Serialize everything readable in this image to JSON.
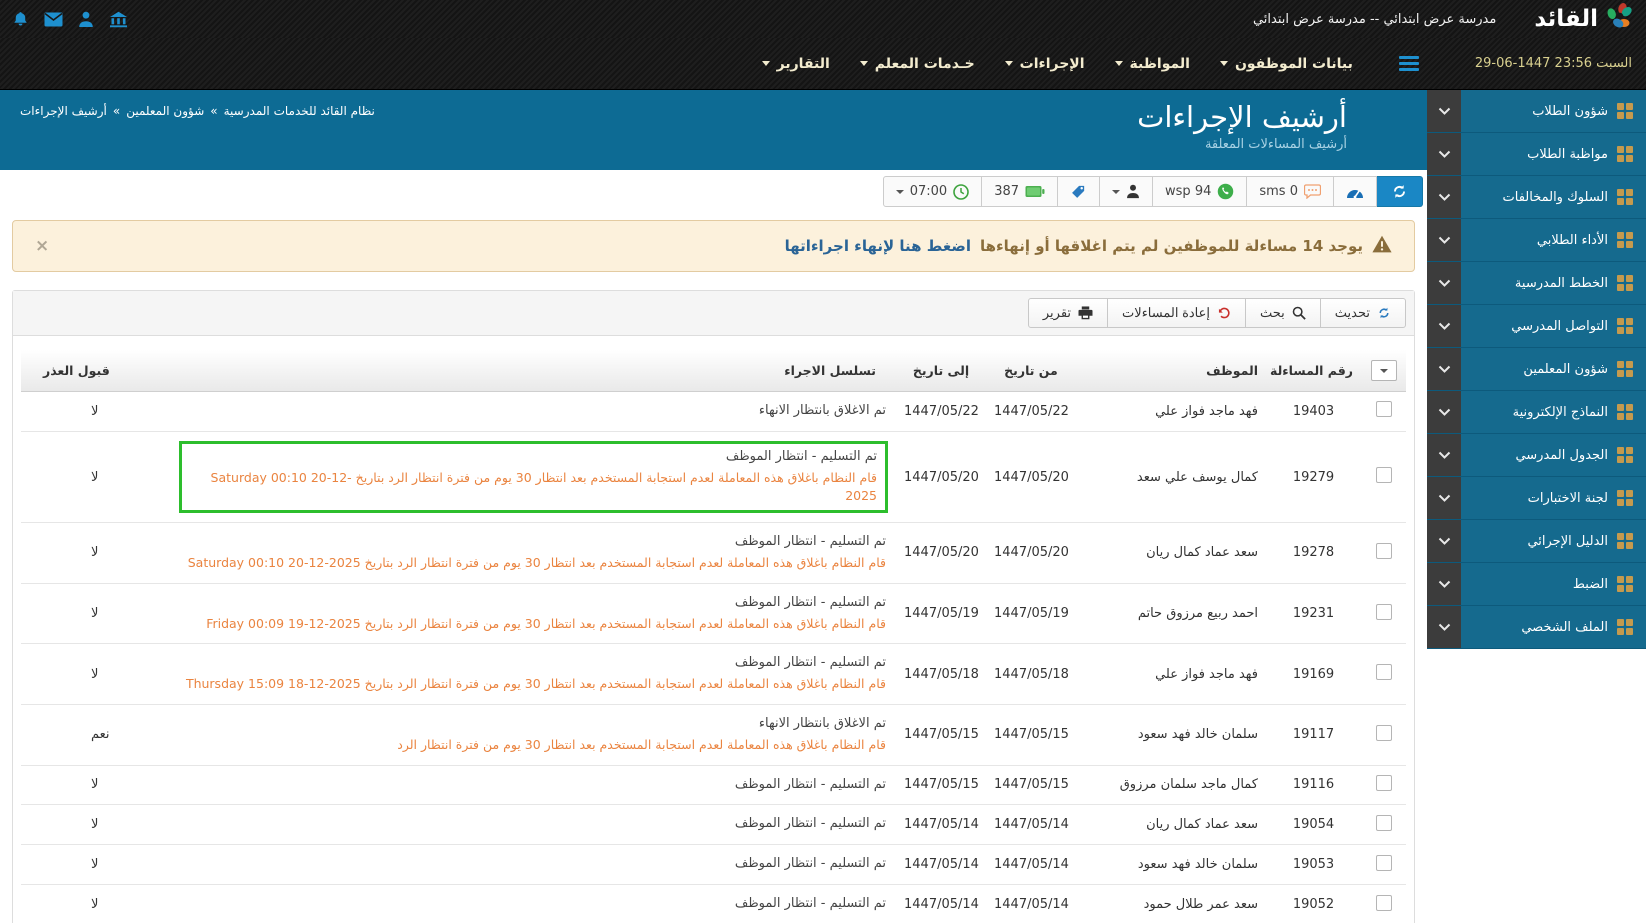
{
  "topbar": {
    "brand": "القائد",
    "school": "مدرسة عرض ابتدائي -- مدرسة عرض ابتدائي",
    "icons": [
      "bell-icon",
      "mail-icon",
      "user-icon",
      "bank-icon"
    ]
  },
  "navbar": {
    "datetime": "29-06-1447 23:56 السبت",
    "menu_icon": "hamburger-icon",
    "items": [
      {
        "label": "بيانات الموظفون"
      },
      {
        "label": "المواظبة"
      },
      {
        "label": "الإجراءات"
      },
      {
        "label": "خـدمات المعلم"
      },
      {
        "label": "التقارير"
      }
    ]
  },
  "sidebar": {
    "items": [
      {
        "label": "شؤون الطلاب"
      },
      {
        "label": "مواظبة الطلاب"
      },
      {
        "label": "السلوك والمخالفات"
      },
      {
        "label": "الأداء الطلابي"
      },
      {
        "label": "الخطط المدرسية"
      },
      {
        "label": "التواصل المدرسي"
      },
      {
        "label": "شؤون المعلمين"
      },
      {
        "label": "النماذج الإلكترونية"
      },
      {
        "label": "الجدول المدرسي"
      },
      {
        "label": "لجنة الاختبارات"
      },
      {
        "label": "الدليل الإجرائي"
      },
      {
        "label": "الضبط"
      },
      {
        "label": "الملف الشخصي"
      }
    ]
  },
  "page_header": {
    "title": "أرشيف الإجراءات",
    "subtitle": "أرشيف المساءلات المعلقة",
    "breadcrumb": {
      "part1": "نظام القائد للخدمات المدرسية",
      "part2": "شؤون المعلمين",
      "part3": "أرشيف الإجراءات",
      "sep": "»"
    }
  },
  "toolbar": {
    "time": "07:00",
    "battery_count": "387",
    "wsp_label": "wsp 94",
    "sms_label": "sms 0",
    "icons": [
      "refresh-icon",
      "speedometer-icon",
      "sms-chat-icon",
      "whatsapp-icon",
      "person-icon",
      "tags-icon",
      "battery-icon",
      "clock-icon"
    ]
  },
  "alert": {
    "text": "يوجد 14 مساءلة للموظفين لم يتم اغلاقها أو إنهاءها",
    "link": "اضغط هنا لإنهاء اجراءاتها",
    "close": "×"
  },
  "actions_bar": {
    "refresh": "تحديث",
    "search": "بحث",
    "reopen": "إعادة المساءلات",
    "report": "تقرير"
  },
  "table": {
    "headers": {
      "id": "رقم المساءلة",
      "employee": "الموظف",
      "from": "من تاريخ",
      "to": "إلى تاريخ",
      "action": "تسلسل الاجراء",
      "excuse": "قبول العذر"
    },
    "rows": [
      {
        "id": "19403",
        "employee": "فهد ماجد فواز علي",
        "from": "1447/05/22",
        "to": "1447/05/22",
        "action": "تم الاغلاق بانتظار الانهاء",
        "note": "",
        "excuse": "لا",
        "highlight": false
      },
      {
        "id": "19279",
        "employee": "كمال يوسف علي سعد",
        "from": "1447/05/20",
        "to": "1447/05/20",
        "action": "تم التسليم - انتظار الموظف",
        "note": "قام النظام باغلاق هذه المعاملة لعدم استجابة المستخدم بعد انتظار 30 يوم من فترة انتظار الرد بتاريخ Saturday 00:10 20-12-2025",
        "excuse": "لا",
        "highlight": true
      },
      {
        "id": "19278",
        "employee": "سعد عماد كمال ريان",
        "from": "1447/05/20",
        "to": "1447/05/20",
        "action": "تم التسليم - انتظار الموظف",
        "note": "قام النظام باغلاق هذه المعاملة لعدم استجابة المستخدم بعد انتظار 30 يوم من فترة انتظار الرد بتاريخ Saturday 00:10 20-12-2025",
        "excuse": "لا",
        "highlight": false
      },
      {
        "id": "19231",
        "employee": "احمد ربيع مرزوق حاتم",
        "from": "1447/05/19",
        "to": "1447/05/19",
        "action": "تم التسليم - انتظار الموظف",
        "note": "قام النظام باغلاق هذه المعاملة لعدم استجابة المستخدم بعد انتظار 30 يوم من فترة انتظار الرد بتاريخ Friday 00:09 19-12-2025",
        "excuse": "لا",
        "highlight": false
      },
      {
        "id": "19169",
        "employee": "فهد ماجد فواز علي",
        "from": "1447/05/18",
        "to": "1447/05/18",
        "action": "تم التسليم - انتظار الموظف",
        "note": "قام النظام باغلاق هذه المعاملة لعدم استجابة المستخدم بعد انتظار 30 يوم من فترة انتظار الرد بتاريخ Thursday 15:09 18-12-2025",
        "excuse": "لا",
        "highlight": false
      },
      {
        "id": "19117",
        "employee": "سلمان خالد فهد سعود",
        "from": "1447/05/15",
        "to": "1447/05/15",
        "action": "تم الاغلاق بانتظار الانهاء",
        "note": "قام النظام باغلاق هذه المعاملة لعدم استجابة المستخدم بعد انتظار 30 يوم من فترة انتظار الرد",
        "excuse": "نعم",
        "highlight": false
      },
      {
        "id": "19116",
        "employee": "كمال ماجد سلمان مرزوق",
        "from": "1447/05/15",
        "to": "1447/05/15",
        "action": "تم التسليم - انتظار الموظف",
        "note": "",
        "excuse": "لا",
        "highlight": false
      },
      {
        "id": "19054",
        "employee": "سعد عماد كمال ريان",
        "from": "1447/05/14",
        "to": "1447/05/14",
        "action": "تم التسليم - انتظار الموظف",
        "note": "",
        "excuse": "لا",
        "highlight": false
      },
      {
        "id": "19053",
        "employee": "سلمان خالد فهد سعود",
        "from": "1447/05/14",
        "to": "1447/05/14",
        "action": "تم التسليم - انتظار الموظف",
        "note": "",
        "excuse": "لا",
        "highlight": false
      },
      {
        "id": "19052",
        "employee": "سعد عمر طلال حمود",
        "from": "1447/05/14",
        "to": "1447/05/14",
        "action": "تم التسليم - انتظار الموظف",
        "note": "",
        "excuse": "لا",
        "highlight": false
      }
    ]
  },
  "colors": {
    "accent_blue": "#1a87c5",
    "icon_blue": "#1e90cf",
    "header_teal": "#0d6b94",
    "sidebar_teal": "#156a8e",
    "sidebar_gold": "#c49a4e",
    "nav_cream": "#f3eccf",
    "date_gold": "#d9d08f",
    "alert_bg": "#fcf1dc",
    "alert_text": "#8a6d3b",
    "note_orange": "#ea8440",
    "highlight_green": "#2dbe2d",
    "whatsapp_green": "#3dae4a",
    "undo_red": "#c9302c"
  }
}
